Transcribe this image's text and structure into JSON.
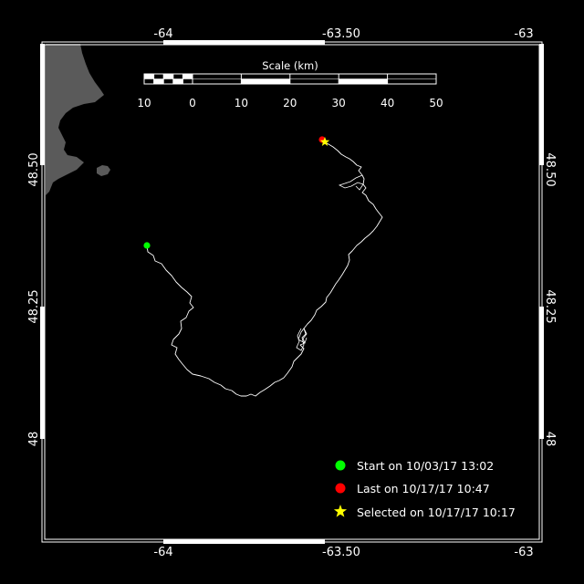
{
  "map": {
    "longitude_ticks": [
      "-64",
      "-63.50",
      "-63"
    ],
    "latitude_ticks": [
      "48.50",
      "48.25",
      "48"
    ],
    "scale_bar": {
      "title": "Scale (km)",
      "labels": [
        "10",
        "0",
        "10",
        "20",
        "30",
        "40",
        "50"
      ]
    }
  },
  "legend": {
    "start": {
      "label": "Start on 10/03/17 13:02",
      "color": "#00ff00"
    },
    "last": {
      "label": "Last on 10/17/17 10:47",
      "color": "#ff0000"
    },
    "selected": {
      "label": "Selected on 10/17/17 10:17",
      "color": "#ffff00"
    }
  },
  "colors": {
    "background": "#000000",
    "land": "#5a5a5a",
    "track": "#ffffff",
    "frame": "#ffffff"
  }
}
